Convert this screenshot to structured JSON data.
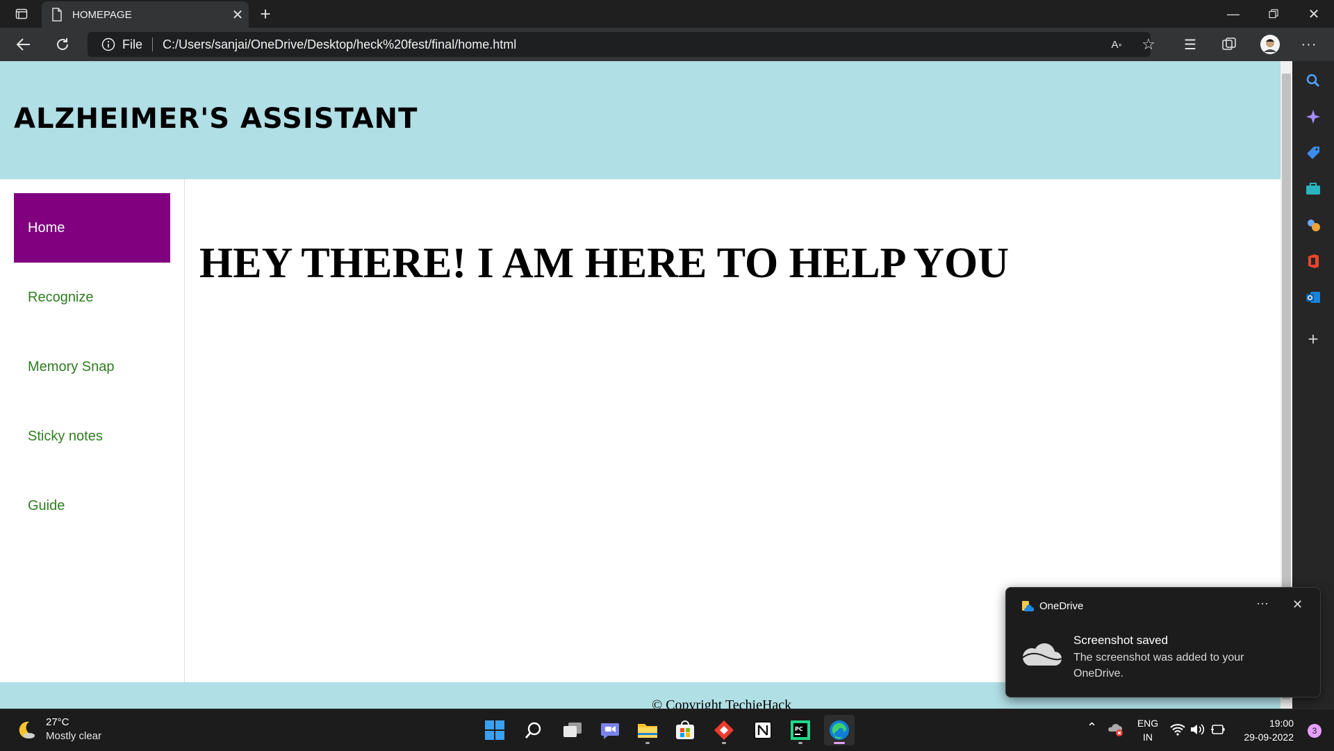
{
  "browser": {
    "tab_title": "HOMEPAGE",
    "protocol_label": "File",
    "url": "C:/Users/sanjai/OneDrive/Desktop/heck%20fest/final/home.html"
  },
  "site": {
    "title": "ALZHEIMER'S ASSISTANT",
    "nav": [
      {
        "label": "Home",
        "active": true
      },
      {
        "label": "Recognize"
      },
      {
        "label": "Memory Snap"
      },
      {
        "label": "Sticky notes"
      },
      {
        "label": "Guide"
      }
    ],
    "heading": "HEY THERE! I AM HERE TO HELP YOU",
    "footer_text": "© Copyright TechieHack"
  },
  "toast": {
    "app": "OneDrive",
    "more": "···",
    "title": "Screenshot saved",
    "body": "The screenshot was added to your OneDrive."
  },
  "taskbar": {
    "weather_temp": "27°C",
    "weather_desc": "Mostly clear",
    "lang_top": "ENG",
    "lang_bottom": "IN",
    "time": "19:00",
    "date": "29-09-2022",
    "notification_count": "3"
  },
  "colors": {
    "header_bg": "#b0dfe5",
    "nav_active_bg": "#800080",
    "nav_link": "#2e7d1f"
  }
}
